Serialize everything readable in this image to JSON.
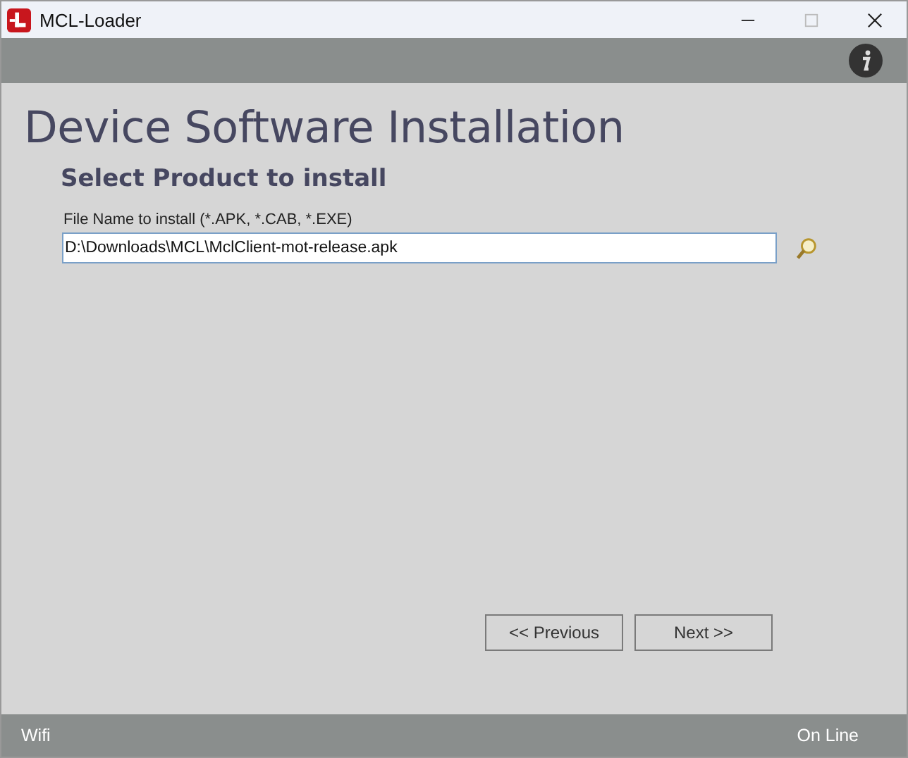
{
  "window": {
    "title": "MCL-Loader"
  },
  "page": {
    "title": "Device Software Installation",
    "subtitle": "Select Product to install"
  },
  "file_field": {
    "label": "File Name to install (*.APK, *.CAB, *.EXE)",
    "value": "D:\\Downloads\\MCL\\MclClient-mot-release.apk"
  },
  "buttons": [
    {
      "label": "<<  Previous"
    },
    {
      "label": "Next  >>"
    }
  ],
  "status_bar": {
    "left": "Wifi",
    "right": "On Line"
  }
}
